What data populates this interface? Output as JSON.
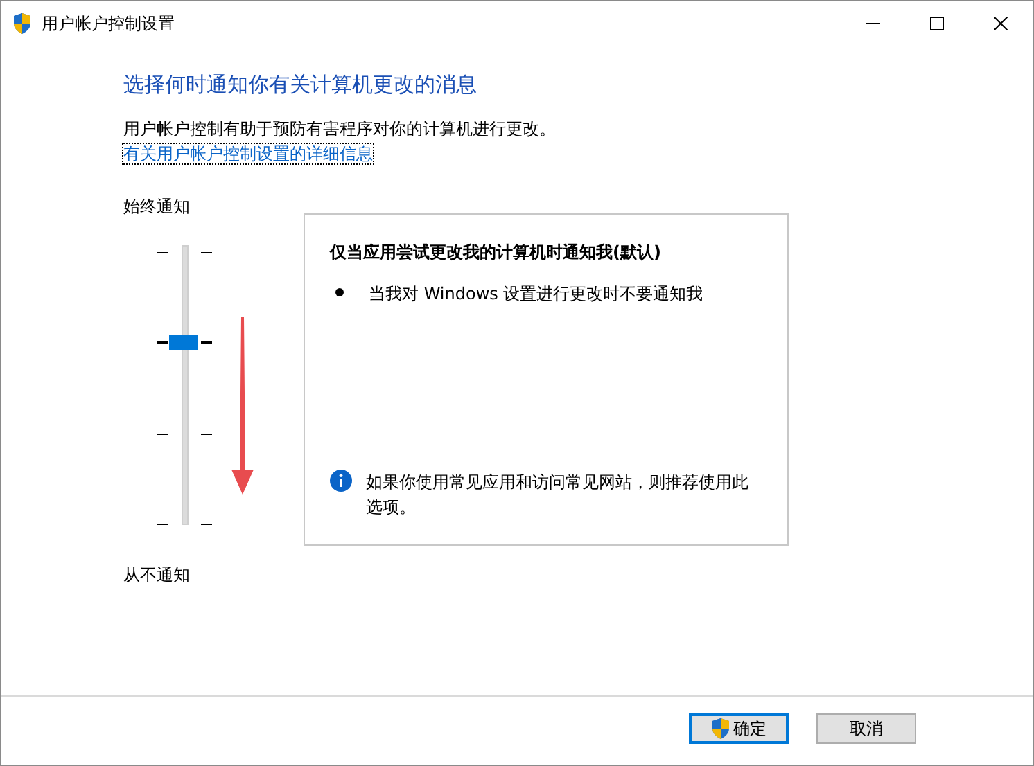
{
  "window": {
    "title": "用户帐户控制设置"
  },
  "heading": "选择何时通知你有关计算机更改的消息",
  "description": "用户帐户控制有助于预防有害程序对你的计算机进行更改。",
  "link": "有关用户帐户控制设置的详细信息",
  "slider": {
    "top_label": "始终通知",
    "bottom_label": "从不通知",
    "level": 0.6667
  },
  "annotation": {
    "kind": "arrow",
    "color": "#e84c4f"
  },
  "panel": {
    "title": "仅当应用尝试更改我的计算机时通知我(默认)",
    "bullets": [
      "当我对 Windows 设置进行更改时不要通知我"
    ],
    "note": "如果你使用常见应用和访问常见网站，则推荐使用此选项。"
  },
  "buttons": [
    {
      "label": "确定",
      "kind": "shield",
      "selected": true
    },
    {
      "label": "取消",
      "kind": "plain",
      "selected": false
    }
  ]
}
